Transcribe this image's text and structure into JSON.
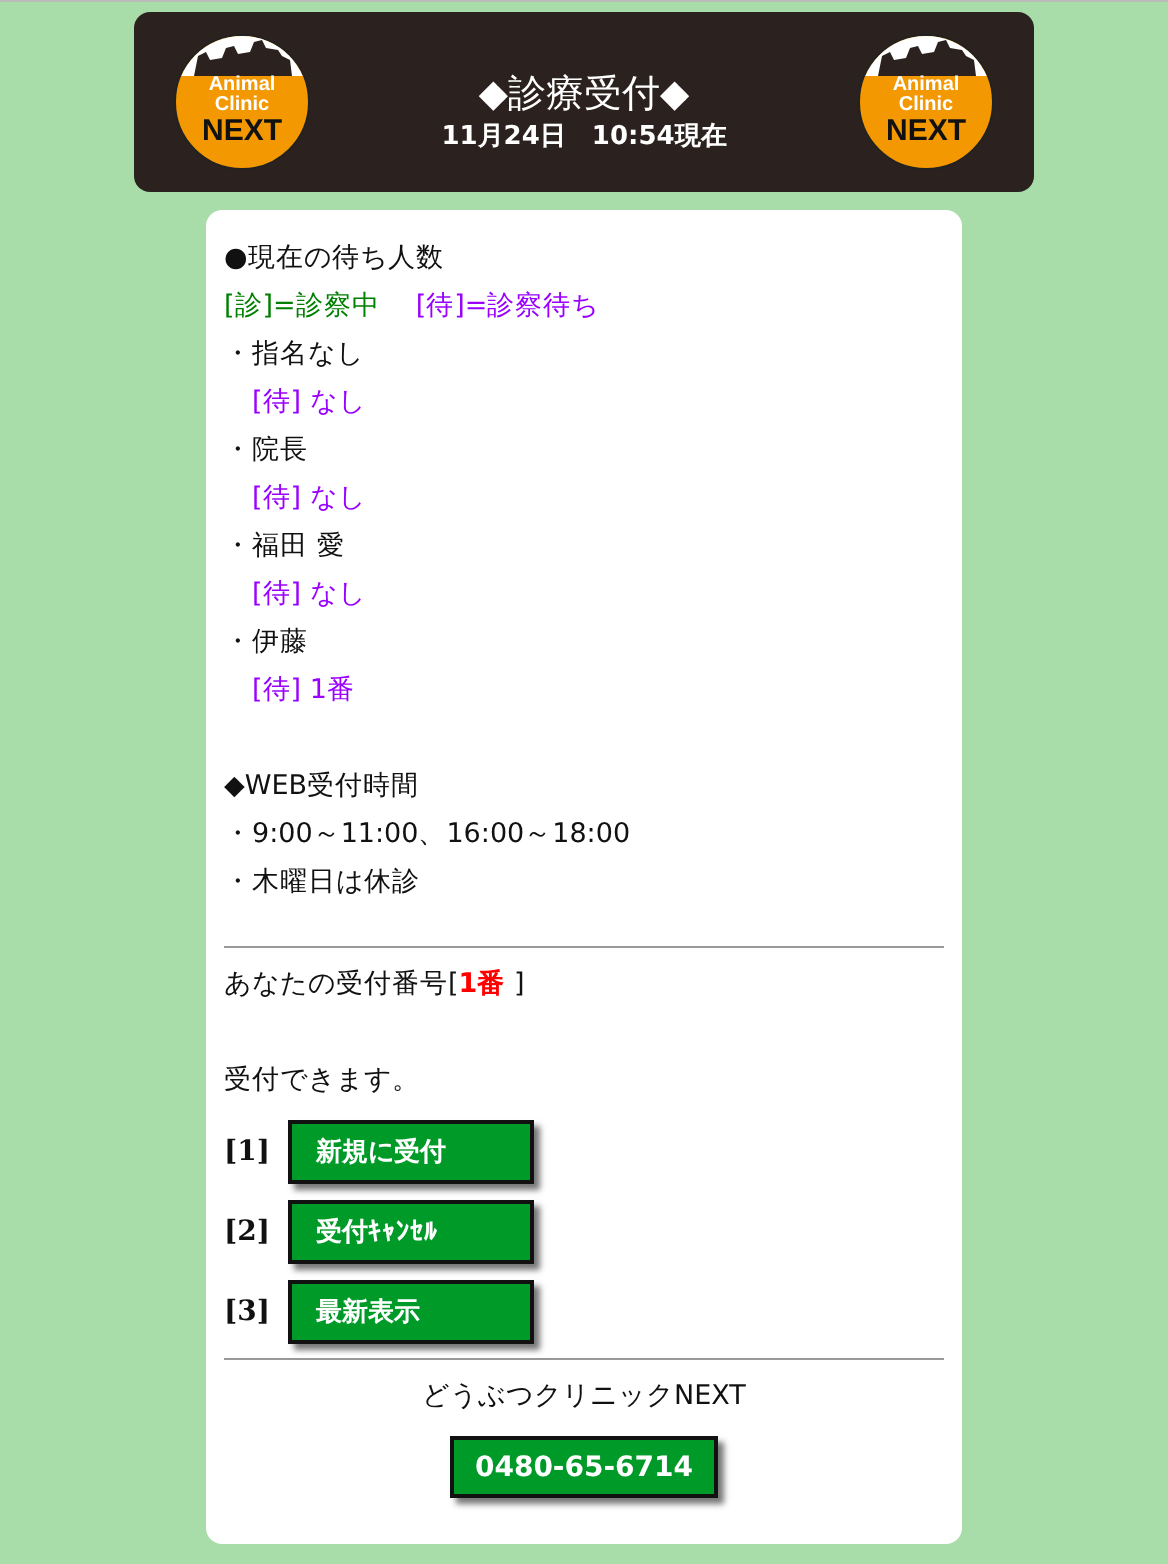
{
  "header": {
    "title": "◆診療受付◆",
    "timestamp": "11月24日　10:54現在",
    "logos": [
      {
        "line_1": "Animal",
        "line_2": "Clinic",
        "line_3": "NEXT"
      },
      {
        "line_1": "Animal",
        "line_2": "Clinic",
        "line_3": "NEXT"
      }
    ]
  },
  "queue": {
    "heading": "●現在の待ち人数",
    "legend": [
      {
        "text": "[診]=診察中",
        "color": "#008000"
      },
      {
        "text": "[待]=診察待ち",
        "color": "#9900ff"
      }
    ],
    "doctors": [
      {
        "name": "・指名なし",
        "waiting": "[待] なし"
      },
      {
        "name": "・院長",
        "waiting": "[待] なし"
      },
      {
        "name": "・福田 愛",
        "waiting": "[待] なし"
      },
      {
        "name": "・伊藤",
        "waiting": "[待] 1番"
      }
    ]
  },
  "hours": {
    "heading": "◆WEB受付時間",
    "lines": [
      "・9:00～11:00、16:00～18:00",
      "・木曜日は休診"
    ]
  },
  "receipt": {
    "label": "あなたの受付番号[",
    "number": "1番",
    "close": " ]"
  },
  "message": "受付できます。",
  "actions": [
    {
      "index": "[1]",
      "label": "新規に受付"
    },
    {
      "index": "[2]",
      "label": "受付ｷｬﾝｾﾙ"
    },
    {
      "index": "[3]",
      "label": "最新表示"
    }
  ],
  "footer": {
    "name": "どうぶつクリニックNEXT",
    "phone": "0480-65-6714"
  }
}
